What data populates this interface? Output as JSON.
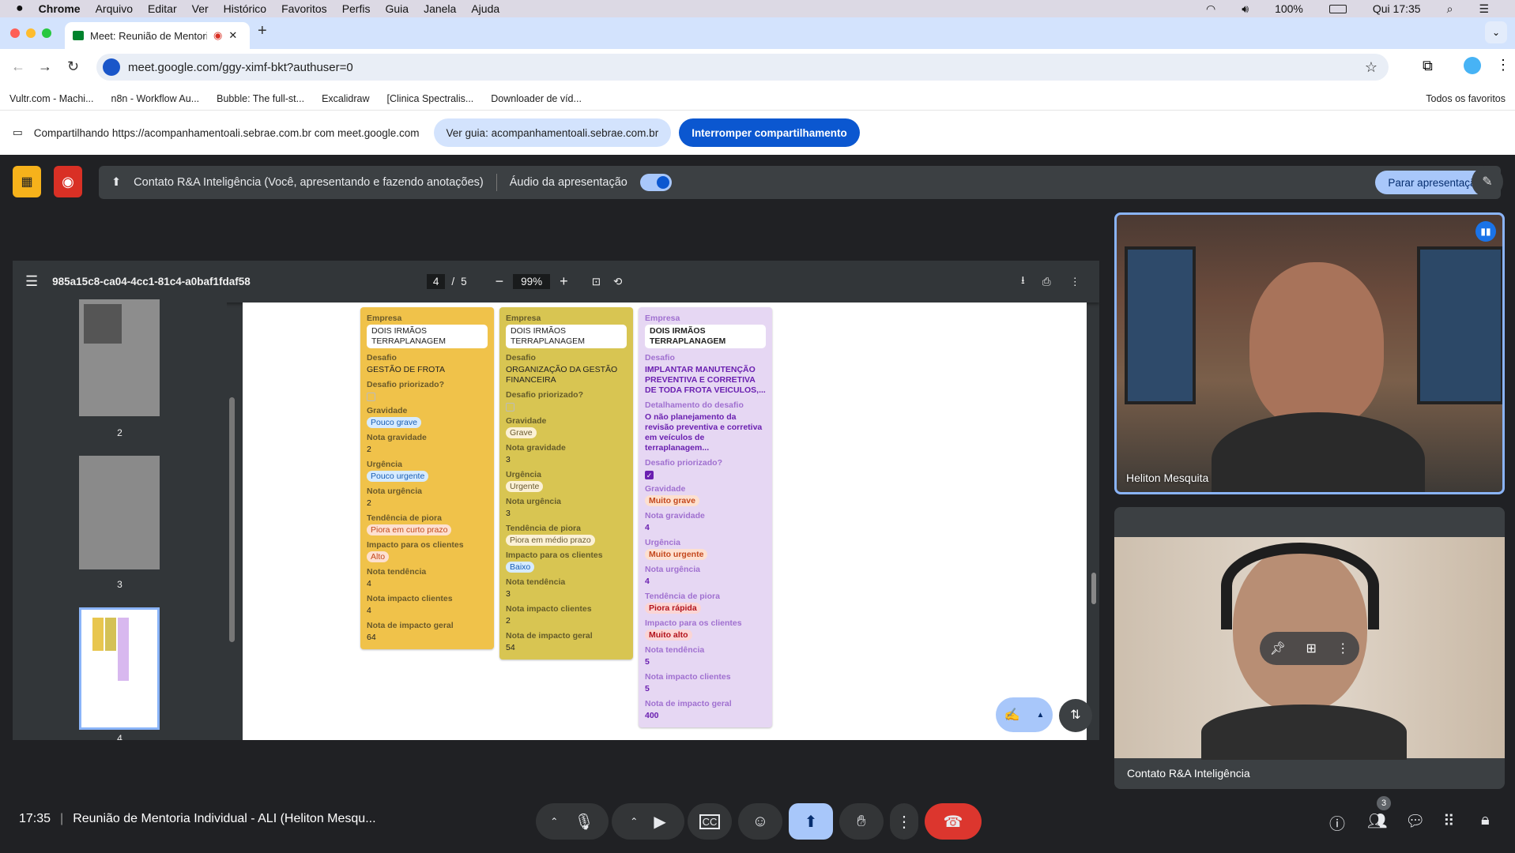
{
  "menubar": {
    "items": [
      "Chrome",
      "Arquivo",
      "Editar",
      "Ver",
      "Histórico",
      "Favoritos",
      "Perfis",
      "Guia",
      "Janela",
      "Ajuda"
    ],
    "battery": "100%",
    "clock": "Qui 17:35"
  },
  "tab": {
    "title": "Meet: Reunião de Mentori"
  },
  "omnibox": {
    "url": "meet.google.com/ggy-ximf-bkt?authuser=0"
  },
  "bookmarks": {
    "items": [
      "Vultr.com - Machi...",
      "n8n - Workflow Au...",
      "Bubble: The full-st...",
      "Excalidraw",
      "[Clinica Spectralis...",
      "Downloader de víd..."
    ],
    "all": "Todos os favoritos"
  },
  "share": {
    "text": "Compartilhando https://acompanhamentoali.sebrae.com.br com meet.google.com",
    "view_tab": "Ver guia: acompanhamentoali.sebrae.com.br",
    "stop": "Interromper compartilhamento"
  },
  "presenting": {
    "text": "Contato R&A Inteligência (Você, apresentando e fazendo anotações)",
    "audio": "Áudio da apresentação",
    "stop": "Parar apresentação"
  },
  "pdf": {
    "filename": "985a15c8-ca04-4cc1-81c4-a0baf1fdaf58",
    "page": "4",
    "total": "5",
    "zoom": "99%",
    "thumb_labels": [
      "2",
      "3",
      "4"
    ]
  },
  "cards": [
    {
      "bg": "#f0c24a",
      "lbl": "#6b5a2a",
      "val": "#222",
      "fields": [
        {
          "label": "Empresa",
          "type": "box",
          "value": "DOIS IRMÃOS TERRAPLANAGEM"
        },
        {
          "label": "Desafio",
          "type": "text",
          "value": "GESTÃO DE FROTA"
        },
        {
          "label": "Desafio priorizado?",
          "type": "check",
          "value": false
        },
        {
          "label": "Gravidade",
          "type": "chip",
          "value": "Pouco grave",
          "chip": "blue"
        },
        {
          "label": "Nota gravidade",
          "type": "text",
          "value": "2"
        },
        {
          "label": "Urgência",
          "type": "chip",
          "value": "Pouco urgente",
          "chip": "blue"
        },
        {
          "label": "Nota urgência",
          "type": "text",
          "value": "2"
        },
        {
          "label": "Tendência de piora",
          "type": "chip",
          "value": "Piora em curto prazo",
          "chip": "orange"
        },
        {
          "label": "Impacto para os clientes",
          "type": "chip",
          "value": "Alto",
          "chip": "orange"
        },
        {
          "label": "Nota tendência",
          "type": "text",
          "value": "4"
        },
        {
          "label": "Nota impacto clientes",
          "type": "text",
          "value": "4"
        },
        {
          "label": "Nota de impacto geral",
          "type": "text",
          "value": "64"
        }
      ]
    },
    {
      "bg": "#d8c552",
      "lbl": "#655c2a",
      "val": "#222",
      "fields": [
        {
          "label": "Empresa",
          "type": "box",
          "value": "DOIS IRMÃOS TERRAPLANAGEM"
        },
        {
          "label": "Desafio",
          "type": "text",
          "value": "ORGANIZAÇÃO DA GESTÃO FINANCEIRA"
        },
        {
          "label": "Desafio priorizado?",
          "type": "check",
          "value": false
        },
        {
          "label": "Gravidade",
          "type": "chip",
          "value": "Grave",
          "chip": "cream"
        },
        {
          "label": "Nota gravidade",
          "type": "text",
          "value": "3"
        },
        {
          "label": "Urgência",
          "type": "chip",
          "value": "Urgente",
          "chip": "cream"
        },
        {
          "label": "Nota urgência",
          "type": "text",
          "value": "3"
        },
        {
          "label": "Tendência de piora",
          "type": "chip",
          "value": "Piora em médio prazo",
          "chip": "cream"
        },
        {
          "label": "Impacto para os clientes",
          "type": "chip",
          "value": "Baixo",
          "chip": "blue"
        },
        {
          "label": "Nota tendência",
          "type": "text",
          "value": "3"
        },
        {
          "label": "Nota impacto clientes",
          "type": "text",
          "value": "2"
        },
        {
          "label": "Nota de impacto geral",
          "type": "text",
          "value": "54"
        }
      ]
    },
    {
      "bg": "#e6d7f3",
      "lbl": "#a070d0",
      "val": "#6a1fb0",
      "fields": [
        {
          "label": "Empresa",
          "type": "box",
          "value": "DOIS IRMÃOS TERRAPLANAGEM"
        },
        {
          "label": "Desafio",
          "type": "text",
          "value": "IMPLANTAR MANUTENÇÃO PREVENTIVA E CORRETIVA DE TODA FROTA VEICULOS,..."
        },
        {
          "label": "Detalhamento do desafio",
          "type": "text",
          "value": "O não planejamento da revisão preventiva e corretiva em veículos de terraplanagem..."
        },
        {
          "label": "Desafio priorizado?",
          "type": "check",
          "value": true
        },
        {
          "label": "Gravidade",
          "type": "chip",
          "value": "Muito grave",
          "chip": "orange"
        },
        {
          "label": "Nota gravidade",
          "type": "text",
          "value": "4"
        },
        {
          "label": "Urgência",
          "type": "chip",
          "value": "Muito urgente",
          "chip": "orange"
        },
        {
          "label": "Nota urgência",
          "type": "text",
          "value": "4"
        },
        {
          "label": "Tendência de piora",
          "type": "chip",
          "value": "Piora rápida",
          "chip": "red"
        },
        {
          "label": "Impacto para os clientes",
          "type": "chip",
          "value": "Muito alto",
          "chip": "red"
        },
        {
          "label": "Nota tendência",
          "type": "text",
          "value": "5"
        },
        {
          "label": "Nota impacto clientes",
          "type": "text",
          "value": "5"
        },
        {
          "label": "Nota de impacto geral",
          "type": "text",
          "value": "400"
        }
      ]
    }
  ],
  "participants": {
    "tile1": "Heliton Mesquita",
    "tile2": "Contato R&A Inteligência",
    "count": "3"
  },
  "meeting": {
    "time": "17:35",
    "title": "Reunião de Mentoria Individual - ALI (Heliton Mesqu..."
  }
}
